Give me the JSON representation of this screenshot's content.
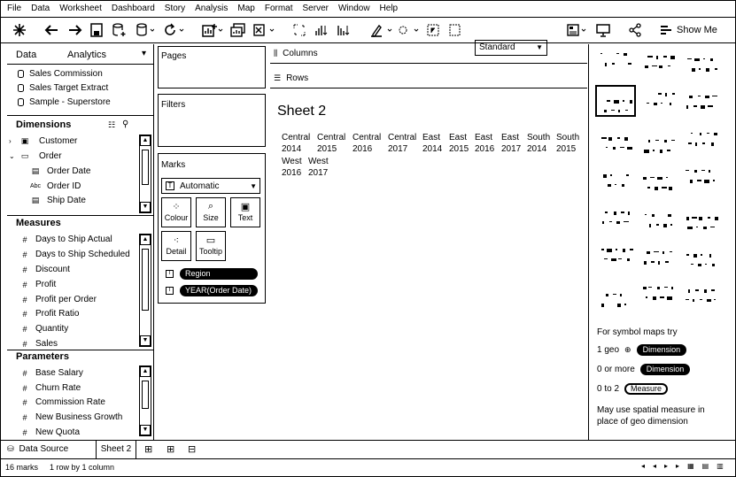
{
  "menu": [
    "File",
    "Data",
    "Worksheet",
    "Dashboard",
    "Story",
    "Analysis",
    "Map",
    "Format",
    "Server",
    "Window",
    "Help"
  ],
  "toolbar": {
    "fit_value": "Standard",
    "show_me_label": "Show Me"
  },
  "data_pane": {
    "tab_data": "Data",
    "tab_analytics": "Analytics",
    "data_sources": [
      "Sales Commission",
      "Sales Target Extract",
      "Sample - Superstore"
    ],
    "dimensions_title": "Dimensions",
    "dimensions": [
      {
        "icon": "folder",
        "label": "Customer"
      },
      {
        "icon": "folder-open",
        "label": "Order"
      },
      {
        "icon": "date",
        "label": "Order Date"
      },
      {
        "icon": "abc",
        "label": "Order ID"
      },
      {
        "icon": "date",
        "label": "Ship Date"
      }
    ],
    "measures_title": "Measures",
    "measures": [
      "Days to Ship Actual",
      "Days to Ship Scheduled",
      "Discount",
      "Profit",
      "Profit per Order",
      "Profit Ratio",
      "Quantity",
      "Sales"
    ],
    "parameters_title": "Parameters",
    "parameters": [
      "Base Salary",
      "Churn Rate",
      "Commission Rate",
      "New Business Growth",
      "New Quota"
    ]
  },
  "shelves": {
    "pages": "Pages",
    "filters": "Filters",
    "marks": "Marks",
    "mark_type": "Automatic",
    "mark_buttons": [
      "Colour",
      "Size",
      "Text",
      "Detail",
      "Tooltip"
    ],
    "mark_pills": [
      "Region",
      "YEAR(Order Date)"
    ],
    "columns": "Columns",
    "rows": "Rows"
  },
  "sheet": {
    "title": "Sheet 2",
    "headers": [
      {
        "top": "Central",
        "bottom": "2014"
      },
      {
        "top": "Central",
        "bottom": "2015"
      },
      {
        "top": "Central",
        "bottom": "2016"
      },
      {
        "top": "Central",
        "bottom": "2017"
      },
      {
        "top": "East",
        "bottom": "2014"
      },
      {
        "top": "East",
        "bottom": "2015"
      },
      {
        "top": "East",
        "bottom": "2016"
      },
      {
        "top": "East",
        "bottom": "2017"
      },
      {
        "top": "South",
        "bottom": "2014"
      },
      {
        "top": "South",
        "bottom": "2015"
      },
      {
        "top": "West",
        "bottom": "2016"
      },
      {
        "top": "West",
        "bottom": "2017"
      }
    ]
  },
  "show_me": {
    "hint_title": "For symbol maps try",
    "rows": [
      {
        "label": "1 geo",
        "pill": "Dimension"
      },
      {
        "label": "0 or more",
        "pill": "Dimension"
      },
      {
        "label": "0 to 2",
        "pill": "Measure"
      }
    ],
    "note_line1": "May use spatial measure in",
    "note_line2": "place of geo dimension"
  },
  "tabs": {
    "data_source": "Data Source",
    "sheet": "Sheet 2"
  },
  "status": {
    "marks": "16 marks",
    "rows_cols": "1 row by 1 column"
  }
}
